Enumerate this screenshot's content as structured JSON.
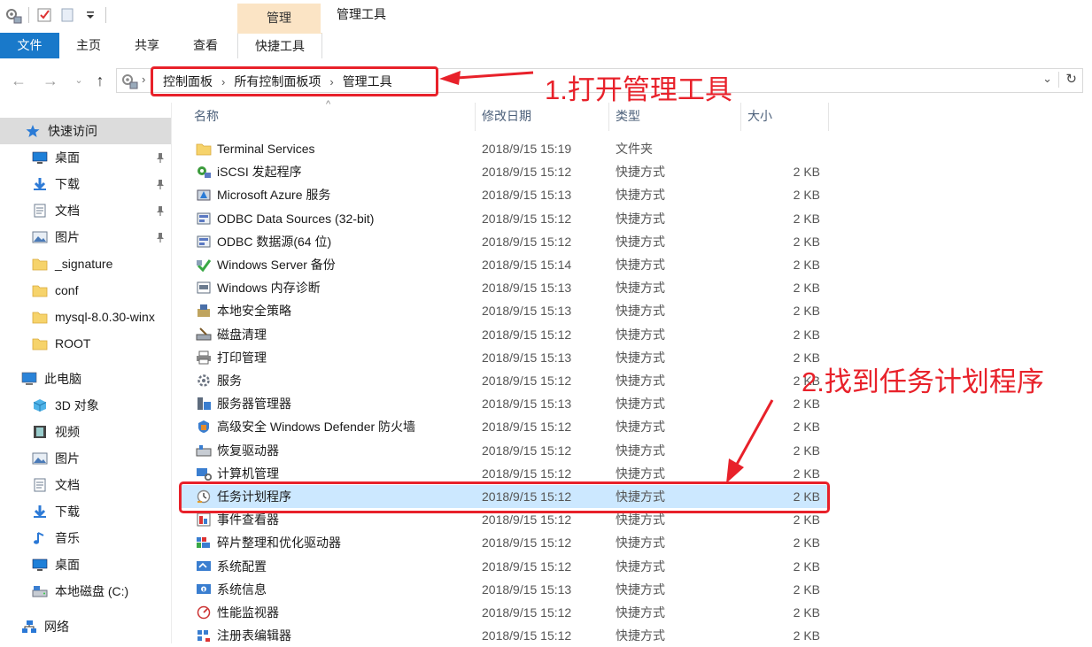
{
  "window": {
    "title": "管理工具",
    "context_tab": "管理"
  },
  "ribbon": {
    "tabs": [
      "文件",
      "主页",
      "共享",
      "查看",
      "快捷工具"
    ]
  },
  "address": {
    "crumbs": [
      "控制面板",
      "所有控制面板项",
      "管理工具"
    ]
  },
  "annotations": {
    "step1": "1.打开管理工具",
    "step2": "2.找到任务计划程序"
  },
  "columns": {
    "name": "名称",
    "date": "修改日期",
    "type": "类型",
    "size": "大小"
  },
  "nav": [
    {
      "label": "快速访问",
      "icon": "star-icon",
      "pinned": false,
      "selected": true
    },
    {
      "label": "桌面",
      "icon": "desktop-icon",
      "pinned": true
    },
    {
      "label": "下载",
      "icon": "download-icon",
      "pinned": true
    },
    {
      "label": "文档",
      "icon": "document-icon",
      "pinned": true
    },
    {
      "label": "图片",
      "icon": "pictures-icon",
      "pinned": true
    },
    {
      "label": "_signature",
      "icon": "folder-icon",
      "pinned": false
    },
    {
      "label": "conf",
      "icon": "folder-icon",
      "pinned": false
    },
    {
      "label": "mysql-8.0.30-winx",
      "icon": "folder-icon",
      "pinned": false
    },
    {
      "label": "ROOT",
      "icon": "folder-icon",
      "pinned": false
    },
    {
      "label": "此电脑",
      "icon": "computer-icon",
      "pinned": false
    },
    {
      "label": "3D 对象",
      "icon": "cube-icon",
      "pinned": false
    },
    {
      "label": "视频",
      "icon": "video-icon",
      "pinned": false
    },
    {
      "label": "图片",
      "icon": "pictures-icon",
      "pinned": false
    },
    {
      "label": "文档",
      "icon": "document-icon",
      "pinned": false
    },
    {
      "label": "下载",
      "icon": "download-icon",
      "pinned": false
    },
    {
      "label": "音乐",
      "icon": "music-icon",
      "pinned": false
    },
    {
      "label": "桌面",
      "icon": "desktop-icon",
      "pinned": false
    },
    {
      "label": "本地磁盘 (C:)",
      "icon": "drive-icon",
      "pinned": false
    },
    {
      "label": "网络",
      "icon": "network-icon",
      "pinned": false
    }
  ],
  "files": [
    {
      "name": "Terminal Services",
      "date": "2018/9/15 15:19",
      "type": "文件夹",
      "size": "",
      "icon": "folder-icon"
    },
    {
      "name": "iSCSI 发起程序",
      "date": "2018/9/15 15:12",
      "type": "快捷方式",
      "size": "2 KB",
      "icon": "iscsi-icon"
    },
    {
      "name": "Microsoft Azure 服务",
      "date": "2018/9/15 15:13",
      "type": "快捷方式",
      "size": "2 KB",
      "icon": "azure-icon"
    },
    {
      "name": "ODBC Data Sources (32-bit)",
      "date": "2018/9/15 15:12",
      "type": "快捷方式",
      "size": "2 KB",
      "icon": "odbc-icon"
    },
    {
      "name": "ODBC 数据源(64 位)",
      "date": "2018/9/15 15:12",
      "type": "快捷方式",
      "size": "2 KB",
      "icon": "odbc-icon"
    },
    {
      "name": "Windows Server 备份",
      "date": "2018/9/15 15:14",
      "type": "快捷方式",
      "size": "2 KB",
      "icon": "backup-icon"
    },
    {
      "name": "Windows 内存诊断",
      "date": "2018/9/15 15:13",
      "type": "快捷方式",
      "size": "2 KB",
      "icon": "memory-icon"
    },
    {
      "name": "本地安全策略",
      "date": "2018/9/15 15:13",
      "type": "快捷方式",
      "size": "2 KB",
      "icon": "security-policy-icon"
    },
    {
      "name": "磁盘清理",
      "date": "2018/9/15 15:12",
      "type": "快捷方式",
      "size": "2 KB",
      "icon": "disk-cleanup-icon"
    },
    {
      "name": "打印管理",
      "date": "2018/9/15 15:13",
      "type": "快捷方式",
      "size": "2 KB",
      "icon": "printer-icon"
    },
    {
      "name": "服务",
      "date": "2018/9/15 15:12",
      "type": "快捷方式",
      "size": "2 KB",
      "icon": "services-icon"
    },
    {
      "name": "服务器管理器",
      "date": "2018/9/15 15:13",
      "type": "快捷方式",
      "size": "2 KB",
      "icon": "server-manager-icon"
    },
    {
      "name": "高级安全 Windows Defender 防火墙",
      "date": "2018/9/15 15:12",
      "type": "快捷方式",
      "size": "2 KB",
      "icon": "firewall-icon"
    },
    {
      "name": "恢复驱动器",
      "date": "2018/9/15 15:12",
      "type": "快捷方式",
      "size": "2 KB",
      "icon": "recovery-drive-icon"
    },
    {
      "name": "计算机管理",
      "date": "2018/9/15 15:12",
      "type": "快捷方式",
      "size": "2 KB",
      "icon": "computer-management-icon"
    },
    {
      "name": "任务计划程序",
      "date": "2018/9/15 15:12",
      "type": "快捷方式",
      "size": "2 KB",
      "icon": "task-scheduler-icon",
      "selected": true
    },
    {
      "name": "事件查看器",
      "date": "2018/9/15 15:12",
      "type": "快捷方式",
      "size": "2 KB",
      "icon": "event-viewer-icon"
    },
    {
      "name": "碎片整理和优化驱动器",
      "date": "2018/9/15 15:12",
      "type": "快捷方式",
      "size": "2 KB",
      "icon": "defrag-icon"
    },
    {
      "name": "系统配置",
      "date": "2018/9/15 15:12",
      "type": "快捷方式",
      "size": "2 KB",
      "icon": "system-config-icon"
    },
    {
      "name": "系统信息",
      "date": "2018/9/15 15:13",
      "type": "快捷方式",
      "size": "2 KB",
      "icon": "system-info-icon"
    },
    {
      "name": "性能监视器",
      "date": "2018/9/15 15:12",
      "type": "快捷方式",
      "size": "2 KB",
      "icon": "performance-monitor-icon"
    },
    {
      "name": "注册表编辑器",
      "date": "2018/9/15 15:12",
      "type": "快捷方式",
      "size": "2 KB",
      "icon": "registry-editor-icon"
    }
  ],
  "colors": {
    "accent": "#1979ca",
    "annotation": "#e8212a",
    "selection": "#cce8ff",
    "context_tab": "#fbe4c5"
  }
}
